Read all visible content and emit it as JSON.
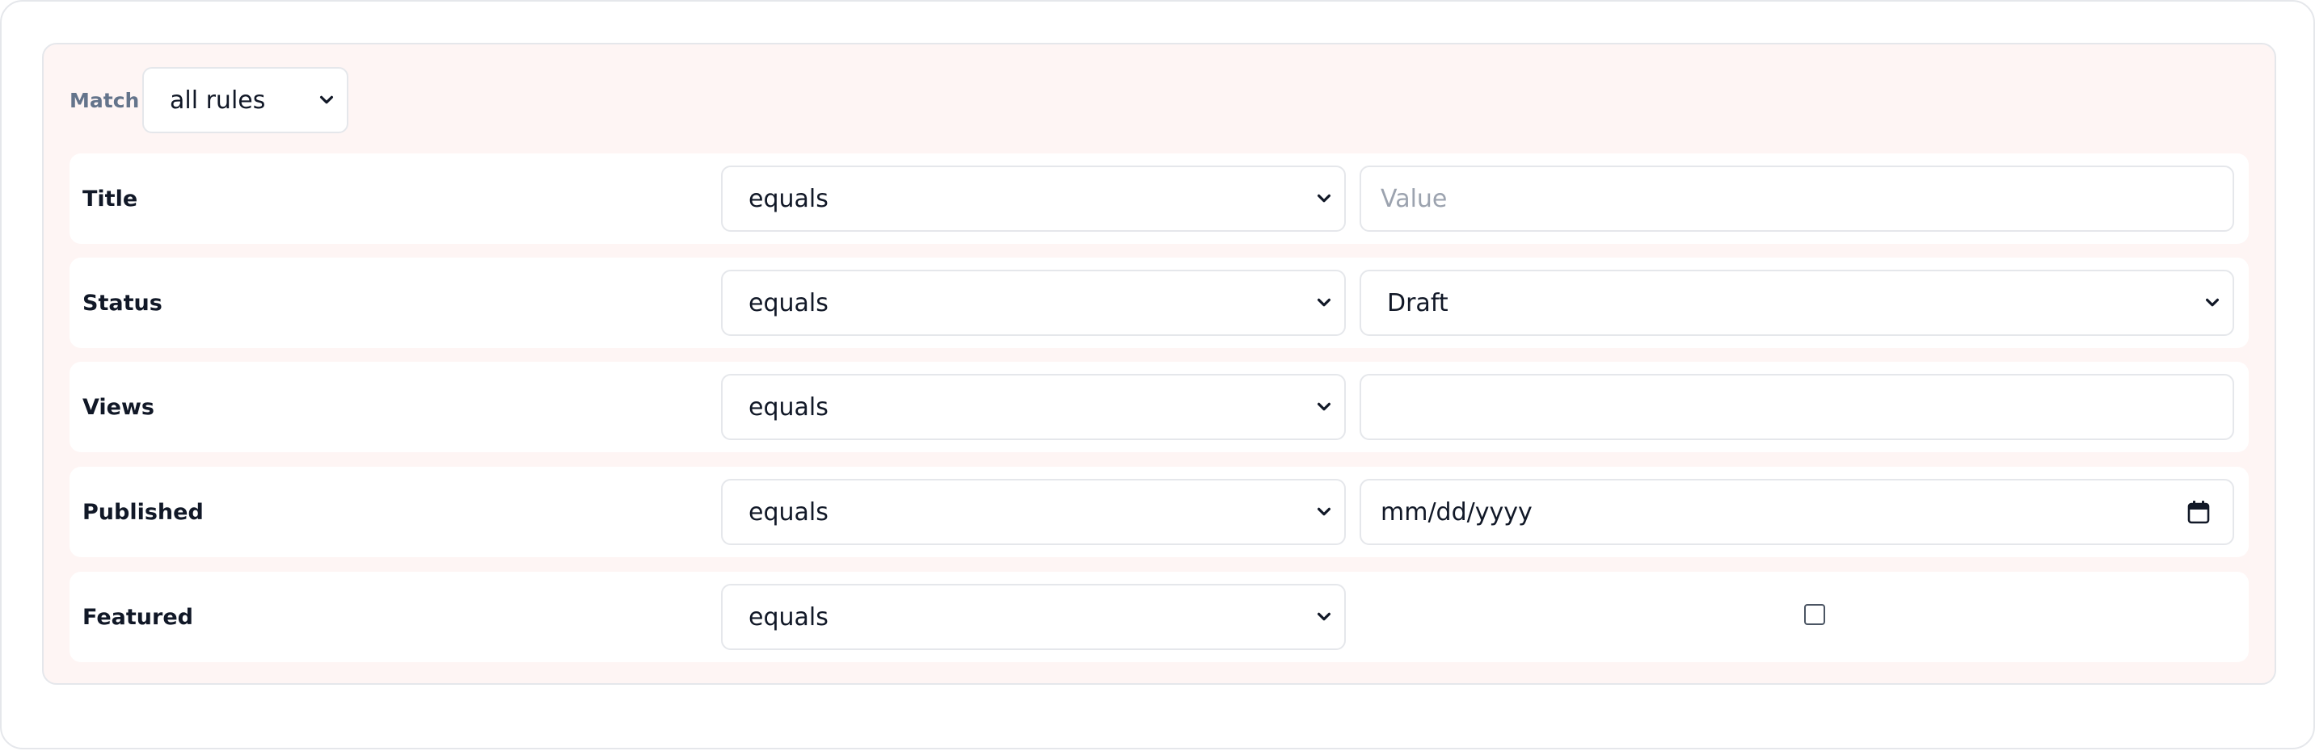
{
  "match": {
    "label": "Match",
    "value": "all rules"
  },
  "rules": [
    {
      "field": "Title",
      "operator": "equals",
      "value": "",
      "placeholder": "Value"
    },
    {
      "field": "Status",
      "operator": "equals",
      "value": "Draft"
    },
    {
      "field": "Views",
      "operator": "equals",
      "value": ""
    },
    {
      "field": "Published",
      "operator": "equals",
      "value": "mm/dd/yyyy"
    },
    {
      "field": "Featured",
      "operator": "equals",
      "checked": false
    }
  ],
  "icons": {
    "chevron": "chevron-down-icon",
    "calendar": "calendar-icon"
  },
  "colors": {
    "group_background": "#fef5f4",
    "border": "#e5e7eb",
    "label_muted": "#64748b"
  }
}
